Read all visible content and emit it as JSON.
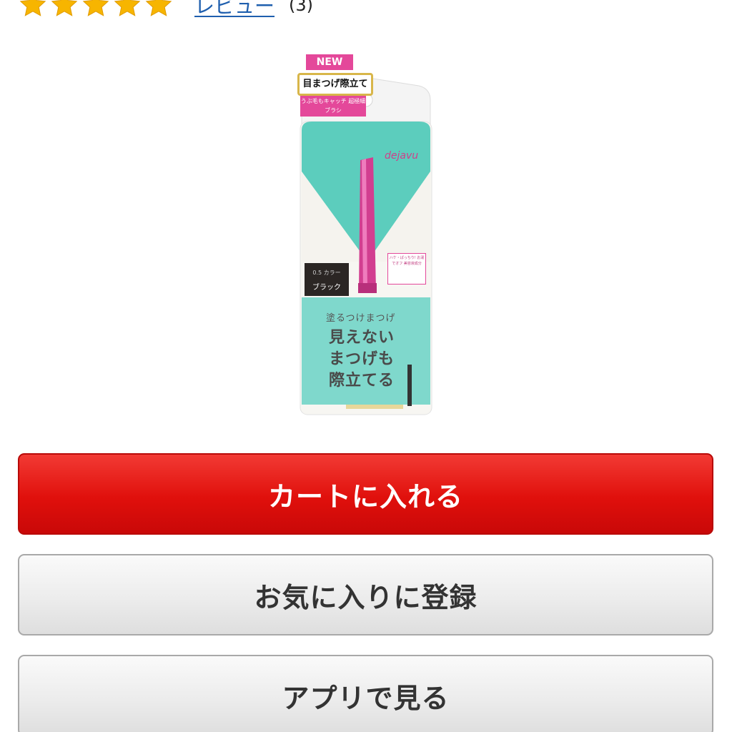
{
  "rating": {
    "stars": 5,
    "star_color": "#f7b500",
    "review_link": "レビュー",
    "review_count": "(3)"
  },
  "product_image": {
    "new_label": "NEW",
    "badge": "目まつげ際立て",
    "pink_note": "うぶ毛もキャッチ 超極細ブラシ",
    "brand": "dejavu",
    "color_label_top": "0.5 カラー",
    "color_label": "ブラック",
    "side_note": "ハケ・ぱっちり! お湯でオフ 美容液成分",
    "subtitle": "塗るつけまつげ",
    "headline": "見えない まつげも 際立てる",
    "accent_teal": "#5ccdbd",
    "accent_pink": "#e4489a"
  },
  "buttons": {
    "add_to_cart": "カートに入れる",
    "add_to_favorites": "お気に入りに登録",
    "view_in_app": "アプリで見る"
  },
  "colors": {
    "cart_button": "#e0100c",
    "secondary_button": "#ececec",
    "link": "#1f5fae"
  }
}
